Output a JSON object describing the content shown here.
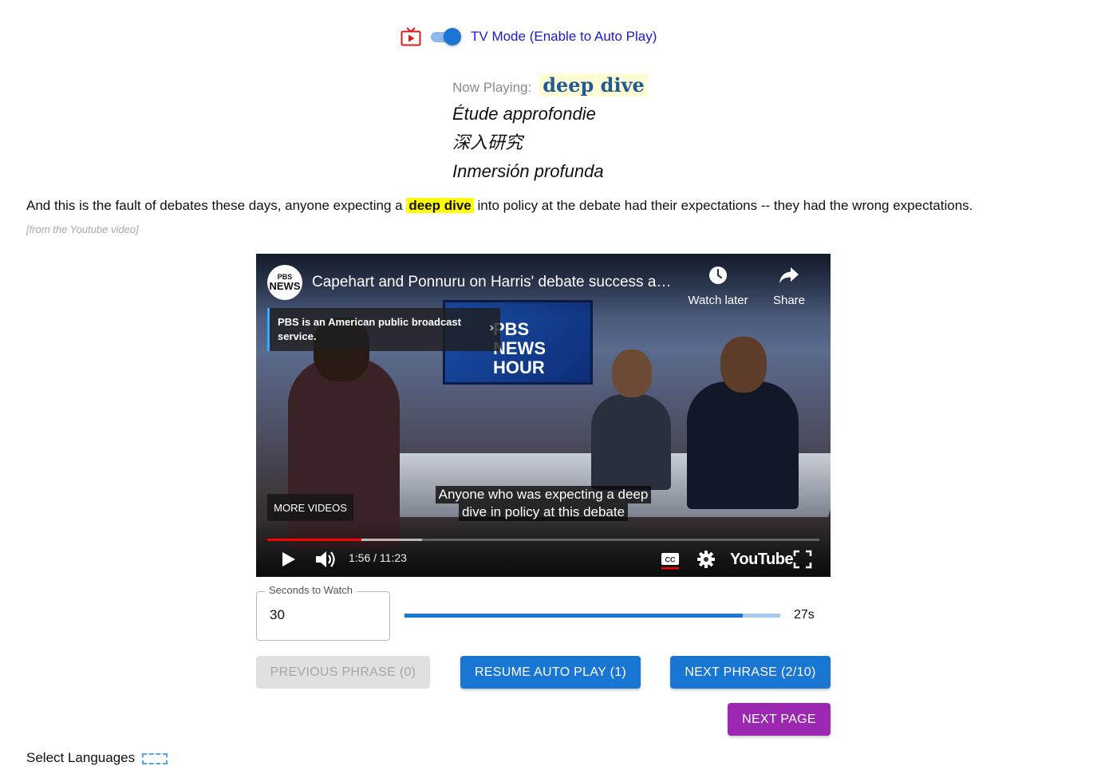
{
  "tv_mode": {
    "label": "TV Mode (Enable to Auto Play)",
    "enabled": true,
    "icon": "tv-play-icon",
    "accent": "#1976d2"
  },
  "now_playing": {
    "label": "Now Playing:",
    "phrase": "deep dive",
    "translations": [
      "Étude approfondie",
      "深入研究",
      "Inmersión profunda"
    ]
  },
  "sentence": {
    "before": "And this is the fault of debates these days, anyone expecting a",
    "highlight": "deep dive",
    "after": "into policy at the debate had their expectations -- they had the wrong expectations.",
    "source": "[from the Youtube video]"
  },
  "video": {
    "channel_avatar_top": "PBS",
    "channel_avatar_bottom": "NEWS",
    "title": "Capehart and Ponnuru on Harris' debate success and Trump's misstep...",
    "watch_later": "Watch later",
    "share": "Share",
    "info_card": "PBS is an American public broadcast service.",
    "studio_logo_line1": "PBS",
    "studio_logo_line2": "NEWS",
    "studio_logo_line3": "HOUR",
    "more_videos": "MORE VIDEOS",
    "caption_line1": "Anyone who was expecting a deep",
    "caption_line2": "dive in policy at this debate",
    "time": "1:56 / 11:23",
    "youtube_logo": "YouTube",
    "progress_played": 0.17,
    "progress_buffered": 0.28
  },
  "seconds_to_watch": {
    "label": "Seconds to Watch",
    "value": "30",
    "remaining_label": "27s",
    "remaining_fraction": 0.9
  },
  "buttons": {
    "previous": "PREVIOUS PHRASE (0)",
    "resume": "RESUME AUTO PLAY (1)",
    "next": "NEXT PHRASE (2/10)",
    "next_page": "NEXT PAGE"
  },
  "select_languages": "Select Languages"
}
